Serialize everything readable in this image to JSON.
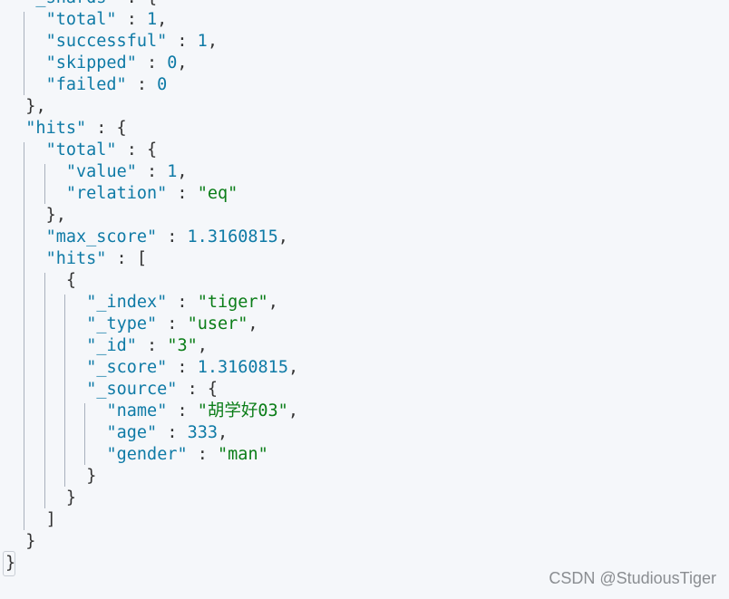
{
  "colors": {
    "background": "#f5f7fa",
    "key": "#0e7aa6",
    "number": "#0e7aa6",
    "string": "#0a7d17",
    "punctuation": "#333333"
  },
  "lines": [
    {
      "level": 1,
      "text": "\"_shards\" : {"
    },
    {
      "level": 2,
      "text": "\"total\" : 1,"
    },
    {
      "level": 2,
      "text": "\"successful\" : 1,"
    },
    {
      "level": 2,
      "text": "\"skipped\" : 0,"
    },
    {
      "level": 2,
      "text": "\"failed\" : 0"
    },
    {
      "level": 1,
      "text": "},"
    },
    {
      "level": 1,
      "text": "\"hits\" : {"
    },
    {
      "level": 2,
      "text": "\"total\" : {"
    },
    {
      "level": 3,
      "text": "\"value\" : 1,"
    },
    {
      "level": 3,
      "text": "\"relation\" : \"eq\""
    },
    {
      "level": 2,
      "text": "},"
    },
    {
      "level": 2,
      "text": "\"max_score\" : 1.3160815,"
    },
    {
      "level": 2,
      "text": "\"hits\" : ["
    },
    {
      "level": 3,
      "text": "{"
    },
    {
      "level": 4,
      "text": "\"_index\" : \"tiger\","
    },
    {
      "level": 4,
      "text": "\"_type\" : \"user\","
    },
    {
      "level": 4,
      "text": "\"_id\" : \"3\","
    },
    {
      "level": 4,
      "text": "\"_score\" : 1.3160815,"
    },
    {
      "level": 4,
      "text": "\"_source\" : {"
    },
    {
      "level": 5,
      "text": "\"name\" : \"胡学好03\","
    },
    {
      "level": 5,
      "text": "\"age\" : 333,"
    },
    {
      "level": 5,
      "text": "\"gender\" : \"man\""
    },
    {
      "level": 4,
      "text": "}"
    },
    {
      "level": 3,
      "text": "}"
    },
    {
      "level": 2,
      "text": "]"
    },
    {
      "level": 1,
      "text": "}"
    },
    {
      "level": 0,
      "text": "}"
    }
  ],
  "watermark": "CSDN @StudiousTiger"
}
